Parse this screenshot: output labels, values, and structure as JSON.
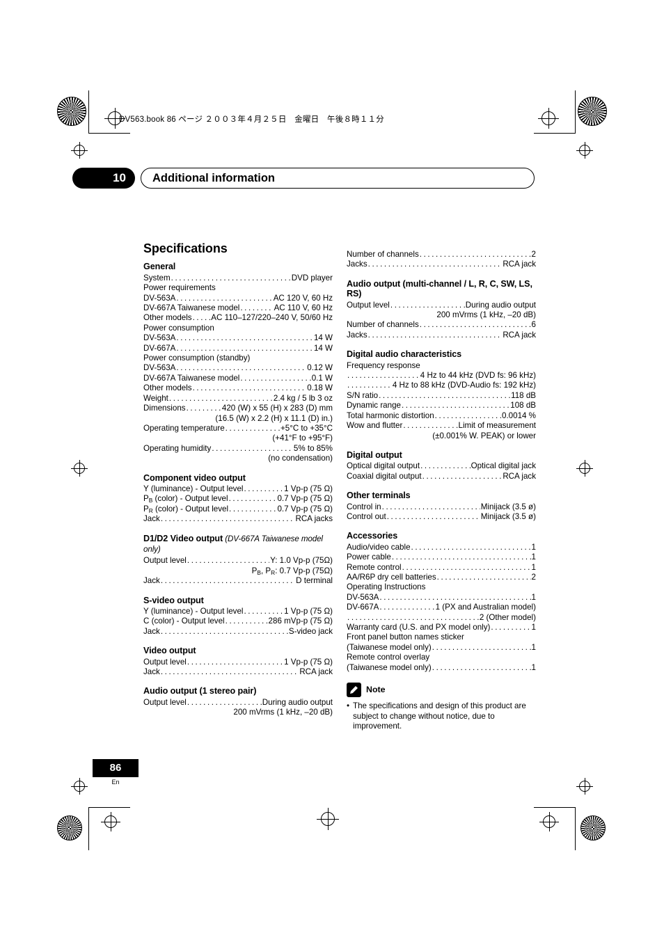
{
  "header": {
    "file_line": "DV563.book  86 ページ  ２００３年４月２５日　金曜日　午後８時１１分"
  },
  "chapter": {
    "number": "10",
    "title": "Additional information"
  },
  "page": {
    "number": "86",
    "lang": "En"
  },
  "title": "Specifications",
  "left_column": [
    {
      "heading": "General",
      "heading_note": "",
      "rows": [
        {
          "type": "dot",
          "label": "System",
          "value": "DVD player"
        },
        {
          "type": "plain",
          "label": "Power requirements"
        },
        {
          "type": "dot",
          "label": "DV-563A",
          "value": "AC 120 V, 60 Hz"
        },
        {
          "type": "dot",
          "label": "DV-667A Taiwanese model",
          "value": "AC 110 V, 60 Hz"
        },
        {
          "type": "dot",
          "label": "Other models",
          "value": "AC 110–127/220–240 V, 50/60 Hz"
        },
        {
          "type": "plain",
          "label": "Power consumption"
        },
        {
          "type": "dot",
          "label": "DV-563A",
          "value": "14 W"
        },
        {
          "type": "dot",
          "label": "DV-667A",
          "value": "14 W"
        },
        {
          "type": "plain",
          "label": "Power consumption (standby)"
        },
        {
          "type": "dot",
          "label": "DV-563A",
          "value": "0.12 W"
        },
        {
          "type": "dot",
          "label": "DV-667A Taiwanese model",
          "value": "0.1 W"
        },
        {
          "type": "dot",
          "label": "Other models",
          "value": "0.18 W"
        },
        {
          "type": "dot",
          "label": "Weight",
          "value": "2.4 kg / 5 lb 3 oz"
        },
        {
          "type": "dot",
          "label": "Dimensions",
          "value": "420 (W) x 55 (H) x 283 (D) mm"
        },
        {
          "type": "right",
          "label": "(16.5 (W) x 2.2 (H) x 11.1 (D) in.)"
        },
        {
          "type": "dot",
          "label": "Operating temperature",
          "value": "+5°C to +35°C"
        },
        {
          "type": "right",
          "label": "(+41°F to +95°F)"
        },
        {
          "type": "dot",
          "label": "Operating humidity",
          "value": "5% to 85%"
        },
        {
          "type": "right",
          "label": "(no condensation)"
        }
      ]
    },
    {
      "heading": "Component video output",
      "heading_note": "",
      "rows": [
        {
          "type": "dot",
          "label": "Y (luminance) - Output level",
          "value": "1 Vp-p (75 Ω)"
        },
        {
          "type": "dot",
          "label": "P<sub>B</sub> (color) - Output level",
          "value": "0.7 Vp-p (75 Ω)",
          "html": true
        },
        {
          "type": "dot",
          "label": "P<sub>R</sub> (color) - Output level",
          "value": "0.7 Vp-p (75 Ω)",
          "html": true
        },
        {
          "type": "dot",
          "label": "Jack",
          "value": "RCA jacks"
        }
      ]
    },
    {
      "heading": "D1/D2 Video output",
      "heading_note": "(DV-667A Taiwanese model only)",
      "rows": [
        {
          "type": "dot",
          "label": "Output level",
          "value": "Y: 1.0 Vp-p (75Ω)"
        },
        {
          "type": "right",
          "label": "P<sub>B</sub>, P<sub>R</sub>: 0.7 Vp-p (75Ω)",
          "html": true
        },
        {
          "type": "dot",
          "label": "Jack",
          "value": "D terminal"
        }
      ]
    },
    {
      "heading": "S-video output",
      "heading_note": "",
      "rows": [
        {
          "type": "dot",
          "label": "Y (luminance) - Output level",
          "value": "1 Vp-p (75 Ω)"
        },
        {
          "type": "dot",
          "label": "C (color) - Output level",
          "value": "286 mVp-p (75 Ω)"
        },
        {
          "type": "dot",
          "label": "Jack",
          "value": "S-video jack"
        }
      ]
    },
    {
      "heading": "Video output",
      "heading_note": "",
      "rows": [
        {
          "type": "dot",
          "label": "Output level",
          "value": "1 Vp-p (75 Ω)"
        },
        {
          "type": "dot",
          "label": "Jack",
          "value": "RCA jack"
        }
      ]
    },
    {
      "heading": "Audio output (1 stereo pair)",
      "heading_note": "",
      "rows": [
        {
          "type": "dot",
          "label": "Output level",
          "value": "During audio output"
        },
        {
          "type": "right",
          "label": "200 mVrms (1 kHz, –20 dB)"
        }
      ]
    }
  ],
  "right_column": [
    {
      "heading": "",
      "heading_note": "",
      "rows": [
        {
          "type": "dot",
          "label": "Number of channels",
          "value": "2"
        },
        {
          "type": "dot",
          "label": "Jacks",
          "value": "RCA jack"
        }
      ]
    },
    {
      "heading": "Audio output (multi-channel / L, R, C, SW, LS, RS)",
      "heading_note": "",
      "rows": [
        {
          "type": "dot",
          "label": "Output level",
          "value": "During audio output"
        },
        {
          "type": "right",
          "label": "200 mVrms (1 kHz, –20 dB)"
        },
        {
          "type": "dot",
          "label": "Number of channels",
          "value": "6"
        },
        {
          "type": "dot",
          "label": "Jacks",
          "value": "RCA jack"
        }
      ]
    },
    {
      "heading": "Digital audio characteristics",
      "heading_note": "",
      "rows": [
        {
          "type": "plain",
          "label": "Frequency response"
        },
        {
          "type": "dot",
          "label": "",
          "value": "4 Hz to 44 kHz (DVD fs: 96 kHz)"
        },
        {
          "type": "dot",
          "label": "",
          "value": "4 Hz to 88 kHz (DVD-Audio fs: 192 kHz)"
        },
        {
          "type": "dot",
          "label": "S/N ratio",
          "value": "118 dB"
        },
        {
          "type": "dot",
          "label": "Dynamic range",
          "value": "108 dB"
        },
        {
          "type": "dot",
          "label": "Total harmonic distortion",
          "value": "0.0014 %"
        },
        {
          "type": "dot",
          "label": "Wow and flutter",
          "value": "Limit of measurement"
        },
        {
          "type": "right",
          "label": "(±0.001% W. PEAK) or lower"
        }
      ]
    },
    {
      "heading": "Digital output",
      "heading_note": "",
      "rows": [
        {
          "type": "dot",
          "label": "Optical digital output",
          "value": "Optical digital jack"
        },
        {
          "type": "dot",
          "label": "Coaxial digital output",
          "value": "RCA jack"
        }
      ]
    },
    {
      "heading": "Other terminals",
      "heading_note": "",
      "rows": [
        {
          "type": "dot",
          "label": "Control in",
          "value": "Minijack (3.5 ø)"
        },
        {
          "type": "dot",
          "label": "Control out",
          "value": "Minijack (3.5 ø)"
        }
      ]
    },
    {
      "heading": "Accessories",
      "heading_note": "",
      "rows": [
        {
          "type": "dot",
          "label": "Audio/video cable",
          "value": "1"
        },
        {
          "type": "dot",
          "label": "Power cable",
          "value": "1"
        },
        {
          "type": "dot",
          "label": "Remote control",
          "value": "1"
        },
        {
          "type": "dot",
          "label": "AA/R6P dry cell batteries",
          "value": "2"
        },
        {
          "type": "plain",
          "label": "Operating Instructions"
        },
        {
          "type": "dot",
          "label": "DV-563A",
          "value": "1"
        },
        {
          "type": "dot",
          "label": "DV-667A",
          "value": "1 (PX and Australian model)"
        },
        {
          "type": "dot",
          "label": "",
          "value": "2 (Other model)"
        },
        {
          "type": "dot",
          "label": "Warranty card (U.S. and PX model only)",
          "value": "1"
        },
        {
          "type": "plain",
          "label": "Front panel button names sticker"
        },
        {
          "type": "dot",
          "label": "(Taiwanese model only)",
          "value": "1"
        },
        {
          "type": "plain",
          "label": "Remote control overlay"
        },
        {
          "type": "dot",
          "label": "(Taiwanese model only)",
          "value": "1"
        }
      ]
    }
  ],
  "note": {
    "title": "Note",
    "bullet": "•",
    "text": "The specifications and design of this product are subject to change without notice, due to improvement."
  }
}
